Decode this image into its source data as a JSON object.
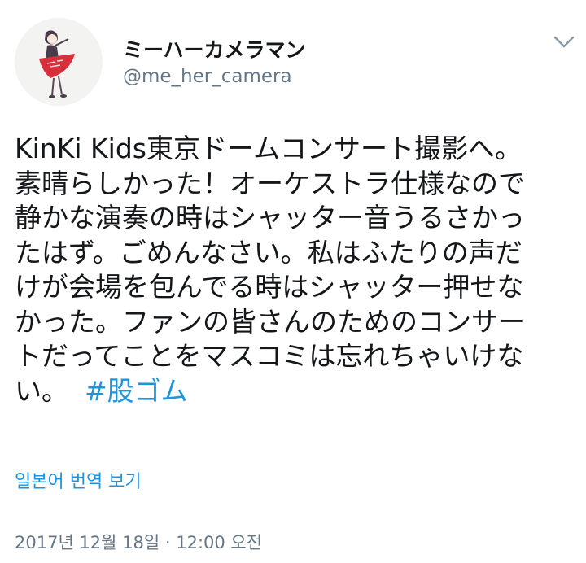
{
  "user": {
    "display_name": "ミーハーカメラマン",
    "handle": "@me_her_camera",
    "avatar_icon": "user-avatar-illustration"
  },
  "menu": {
    "icon": "chevron-down-icon"
  },
  "tweet": {
    "lines": [
      "KinKi Kids東京ドームコンサート撮影へ。",
      "素晴らしかった！オーケストラ仕様なので",
      "静かな演奏の時はシャッター音うるさかっ",
      "たはず。ごめんなさい。私はふたりの声だ",
      "けが会場を包んでる時はシャッター押せな",
      "かった。ファンの皆さんのためのコンサー",
      "トだってことをマスコミは忘れちゃいけな",
      "い。"
    ],
    "hashtag": "#股ゴム"
  },
  "translate_link": "일본어 번역 보기",
  "timestamp": "2017년 12월 18일 · 12:00 오전",
  "colors": {
    "text": "#14171a",
    "secondary": "#657786",
    "link": "#1b95e0"
  }
}
